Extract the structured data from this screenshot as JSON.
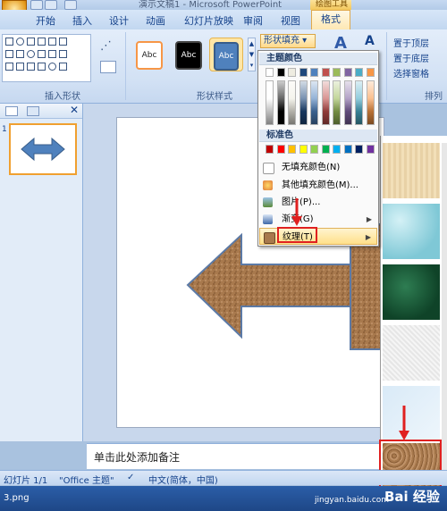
{
  "window": {
    "title": "演示文稿1 - Microsoft PowerPoint",
    "contextual_tab_group": "绘图工具"
  },
  "tabs": [
    "开始",
    "插入",
    "设计",
    "动画",
    "幻灯片放映",
    "审阅",
    "视图"
  ],
  "active_tab": "格式",
  "ribbon": {
    "insert_shapes_label": "插入形状",
    "shape_styles_label": "形状样式",
    "arrange_label": "排列",
    "style_thumb_text": "Abc",
    "shape_fill_button": "形状填充",
    "bring_forward": "置于顶层",
    "send_backward": "置于底层",
    "selection_pane": "选择窗格"
  },
  "fill_menu": {
    "theme_colors_header": "主题颜色",
    "standard_colors_header": "标准色",
    "theme_colors_top": [
      "#ffffff",
      "#000000",
      "#eeece1",
      "#1f497d",
      "#4f81bd",
      "#c0504d",
      "#9bbb59",
      "#8064a2",
      "#4bacc6",
      "#f79646"
    ],
    "standard_colors": [
      "#c00000",
      "#ff0000",
      "#ffc000",
      "#ffff00",
      "#92d050",
      "#00b050",
      "#00b0f0",
      "#0070c0",
      "#002060",
      "#7030a0"
    ],
    "items": [
      {
        "label": "无填充颜色(N)",
        "icon": "no-fill-icon",
        "submenu": false
      },
      {
        "label": "其他填充颜色(M)...",
        "icon": "color-palette-icon",
        "submenu": false
      },
      {
        "label": "图片(P)...",
        "icon": "picture-icon",
        "submenu": false
      },
      {
        "label": "渐变(G)",
        "icon": "gradient-icon",
        "submenu": true
      },
      {
        "label": "纹理(T)",
        "icon": "texture-icon",
        "submenu": true
      }
    ]
  },
  "notes_placeholder": "单击此处添加备注",
  "status_bar": {
    "slide_counter": "幻灯片 1/1",
    "theme": "\"Office 主题\"",
    "language": "中文(简体，中国)"
  },
  "taskbar_label": "3.png",
  "watermark": {
    "site": "jingyan.baidu.com",
    "logo": "Bai 经验"
  },
  "colors": {
    "texture_applied": "#a8794d",
    "highlight_red": "#e02020",
    "ribbon_blue": "#15428b"
  }
}
